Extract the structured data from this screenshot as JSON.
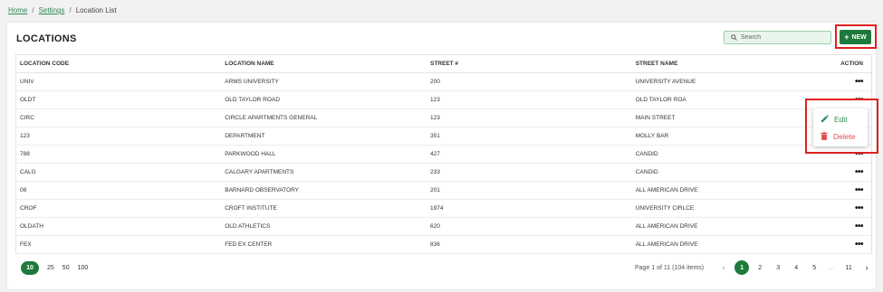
{
  "breadcrumb": {
    "home": "Home",
    "settings": "Settings",
    "current": "Location List",
    "separator": "/"
  },
  "page": {
    "title": "LOCATIONS"
  },
  "search": {
    "placeholder": "Search",
    "value": ""
  },
  "toolbar": {
    "new_label": "NEW",
    "new_icon": "plus-icon"
  },
  "table": {
    "headers": [
      "LOCATION CODE",
      "LOCATION NAME",
      "STREET #",
      "STREET NAME",
      "ACTION"
    ],
    "rows": [
      [
        "UNIV",
        "ARMS UNIVERSITY",
        "200",
        "UNIVERSITY AVENUE"
      ],
      [
        "OLDT",
        "OLD TAYLOR ROAD",
        "123",
        "OLD TAYLOR ROA"
      ],
      [
        "CIRC",
        "CIRCLE APARTMENTS GENERAL",
        "123",
        "MAIN STREET"
      ],
      [
        "123",
        "DEPARTMENT",
        "351",
        "MOLLY BAR"
      ],
      [
        "788",
        "PARKWOOD HALL",
        "427",
        "CANDID"
      ],
      [
        "CALG",
        "CALGARY APARTMENTS",
        "233",
        "CANDID"
      ],
      [
        "08",
        "BARNARD OBSERVATORY",
        "201",
        "ALL AMERICAN DRIVE"
      ],
      [
        "CROF",
        "CROFT INSTITUTE",
        "1974",
        "UNIVERSITY CIRLCE"
      ],
      [
        "OLDATH",
        "OLD ATHLETICS",
        "620",
        "ALL AMERICAN DRIVE"
      ],
      [
        "FEX",
        "FED EX CENTER",
        "836",
        "ALL AMERICAN DRIVE"
      ]
    ],
    "action_glyph": "•••"
  },
  "action_menu": {
    "edit_label": "Edit",
    "delete_label": "Delete",
    "edit_icon": "pencil-icon",
    "delete_icon": "trash-icon"
  },
  "pagination": {
    "page_sizes": [
      "10",
      "25",
      "50",
      "100"
    ],
    "selected_size": "10",
    "info": "Page 1 of 11 (104 items)",
    "pages": [
      "1",
      "2",
      "3",
      "4",
      "5"
    ],
    "ellipsis": "...",
    "last_page": "11",
    "current_page": "1"
  },
  "colors": {
    "accent": "#1e7a3c",
    "highlight": "#e02020",
    "delete": "#e05050"
  }
}
